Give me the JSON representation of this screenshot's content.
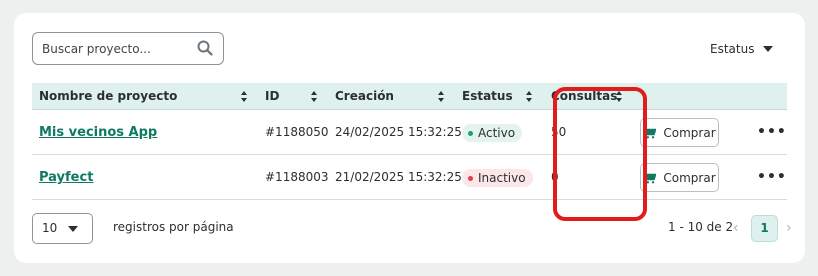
{
  "search": {
    "placeholder": "Buscar proyecto..."
  },
  "status_filter": {
    "label": "Estatus"
  },
  "table": {
    "headers": {
      "name": "Nombre de proyecto",
      "id": "ID",
      "created": "Creación",
      "status": "Estatus",
      "queries": "Consultas"
    },
    "rows": [
      {
        "name": "Mis vecinos App",
        "id": "#1188050",
        "created": "24/02/2025 15:32:25",
        "status": "Activo",
        "queries": "50",
        "buy_label": "Comprar",
        "more": "•••"
      },
      {
        "name": "Payfect",
        "id": "#1188003",
        "created": "21/02/2025 15:32:25",
        "status": "Inactivo",
        "queries": "0",
        "buy_label": "Comprar",
        "more": "•••"
      }
    ]
  },
  "pagination": {
    "per_page_value": "10",
    "per_page_label": "registros por página",
    "range": "1 - 10 de 2",
    "prev": "‹",
    "current_page": "1",
    "next": "›"
  },
  "colors": {
    "accent": "#0f7a63",
    "header_bg": "#dff1ef",
    "highlight": "#e01c1c",
    "active_dot": "#1e9c74",
    "inactive_dot": "#e0404e"
  }
}
